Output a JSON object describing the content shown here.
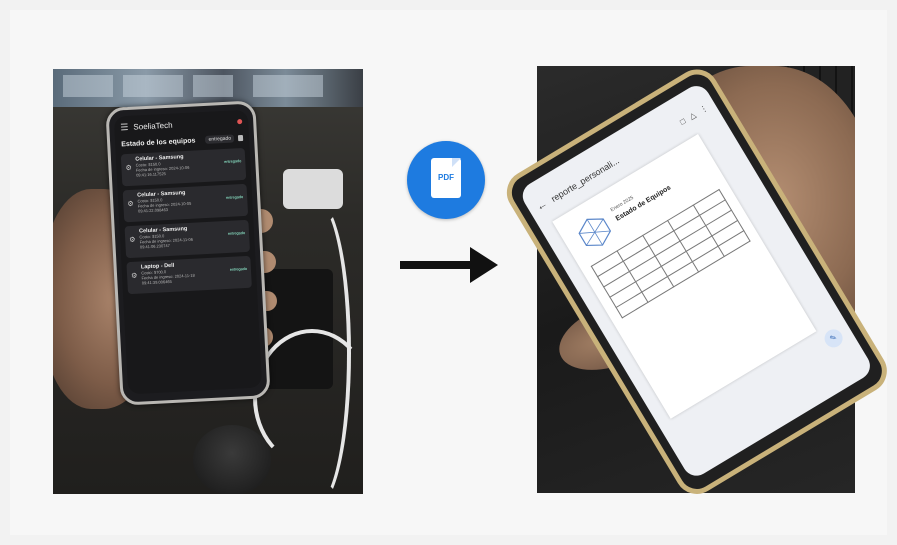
{
  "left_phone": {
    "app_title": "SoeliaTech",
    "section_title": "Estado de los equipos",
    "filter_label": "entregado",
    "cards": [
      {
        "title": "Celular - Samsung",
        "line1": "Costo: $150.0",
        "line2": "Fecha de ingreso: 2024-10-06",
        "line3": "09:41:16.117525",
        "status": "entregado"
      },
      {
        "title": "Celular - Samsung",
        "line1": "Costo: $150.0",
        "line2": "Fecha de ingreso: 2024-10-05",
        "line3": "09:41:22.098463",
        "status": "entregado"
      },
      {
        "title": "Celular - Samsung",
        "line1": "Costo: $150.0",
        "line2": "Fecha de ingreso: 2024-11-06",
        "line3": "09:41:06.230747",
        "status": "entregado"
      },
      {
        "title": "Laptop - Dell",
        "line1": "Costo: $700.0",
        "line2": "Fecha de ingreso: 2024-11-18",
        "line3": "09:41:39.006465",
        "status": "entregado"
      }
    ]
  },
  "center": {
    "pdf_label": "PDF"
  },
  "right_phone": {
    "doc_title": "reporte_personali...",
    "doc_date": "Enero 2025",
    "doc_heading": "Estado de Equipos"
  },
  "icons": {
    "menu": "menu-icon",
    "device": "phonelink-icon",
    "back": "arrow-back-icon",
    "share": "share-icon",
    "drive": "drive-icon",
    "more": "more-vert-icon",
    "fab": "edit-icon"
  },
  "colors": {
    "pdf_badge": "#1e7be0",
    "arrow": "#111111",
    "phone_right_frame": "#c9b27a"
  }
}
